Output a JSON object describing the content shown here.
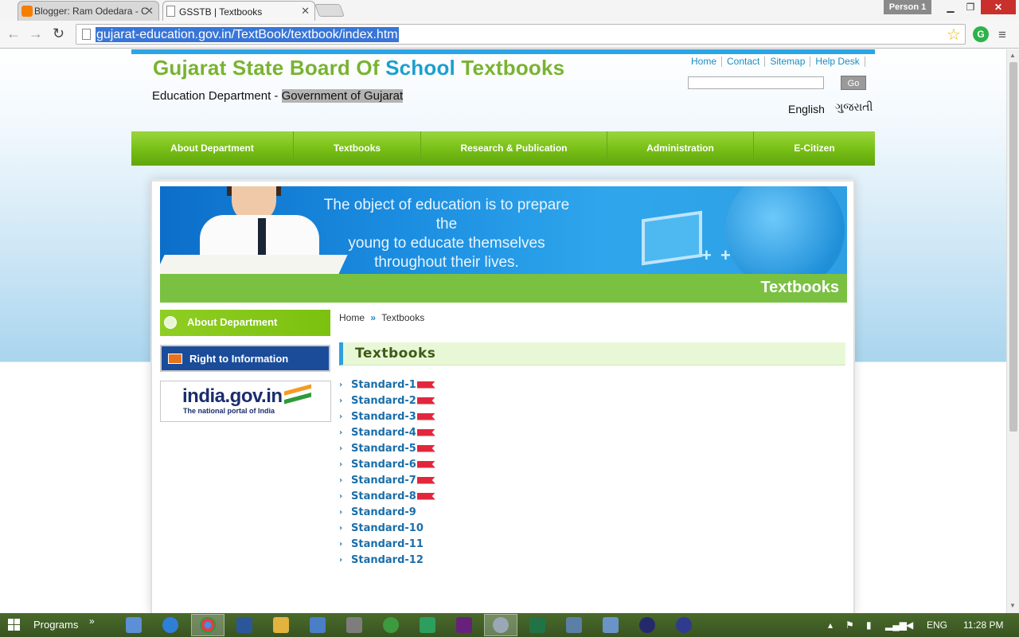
{
  "browser": {
    "tabs": [
      {
        "title": "Blogger: Ram Odedara - C",
        "active": false
      },
      {
        "title": "GSSTB | Textbooks",
        "active": true
      }
    ],
    "profile": "Person 1",
    "url": "gujarat-education.gov.in/TextBook/textbook/index.htm"
  },
  "site": {
    "title_part1": "Gujarat State Board Of ",
    "title_part2": "School",
    "title_part3": " Textbooks",
    "subtitle_plain": "Education Department - ",
    "subtitle_hl": "Government of Gujarat",
    "toplinks": [
      "Home",
      "Contact",
      "Sitemap",
      "Help Desk"
    ],
    "go_label": "Go",
    "lang_english": "English",
    "lang_gujarati": "ગુજરાતી",
    "nav": [
      "About Department",
      "Textbooks",
      "Research & Publication",
      "Administration",
      "E-Citizen"
    ],
    "banner_quote": [
      "The object of education is to prepare the",
      "young to educate themselves",
      "throughout their lives."
    ],
    "section_title": "Textbooks",
    "side_about": "About Department",
    "side_rti": "Right to Information",
    "india_logo": "india.gov.in",
    "india_tagline": "The national portal of India",
    "breadcrumb": {
      "home": "Home",
      "sep": "»",
      "current": "Textbooks"
    },
    "page_title": "Textbooks",
    "standards": [
      {
        "label": "Standard-1",
        "new": true
      },
      {
        "label": "Standard-2",
        "new": true
      },
      {
        "label": "Standard-3",
        "new": true
      },
      {
        "label": "Standard-4",
        "new": true
      },
      {
        "label": "Standard-5",
        "new": true
      },
      {
        "label": "Standard-6",
        "new": true
      },
      {
        "label": "Standard-7",
        "new": true
      },
      {
        "label": "Standard-8",
        "new": true
      },
      {
        "label": "Standard-9",
        "new": false
      },
      {
        "label": "Standard-10",
        "new": false
      },
      {
        "label": "Standard-11",
        "new": false
      },
      {
        "label": "Standard-12",
        "new": false
      }
    ]
  },
  "taskbar": {
    "programs": "Programs",
    "lang": "ENG",
    "time": "11:28 PM"
  },
  "colors": {
    "accent_green": "#7ac142",
    "accent_blue": "#2aa5e8",
    "link_blue": "#1c6ea8",
    "new_badge": "#e3263b"
  }
}
